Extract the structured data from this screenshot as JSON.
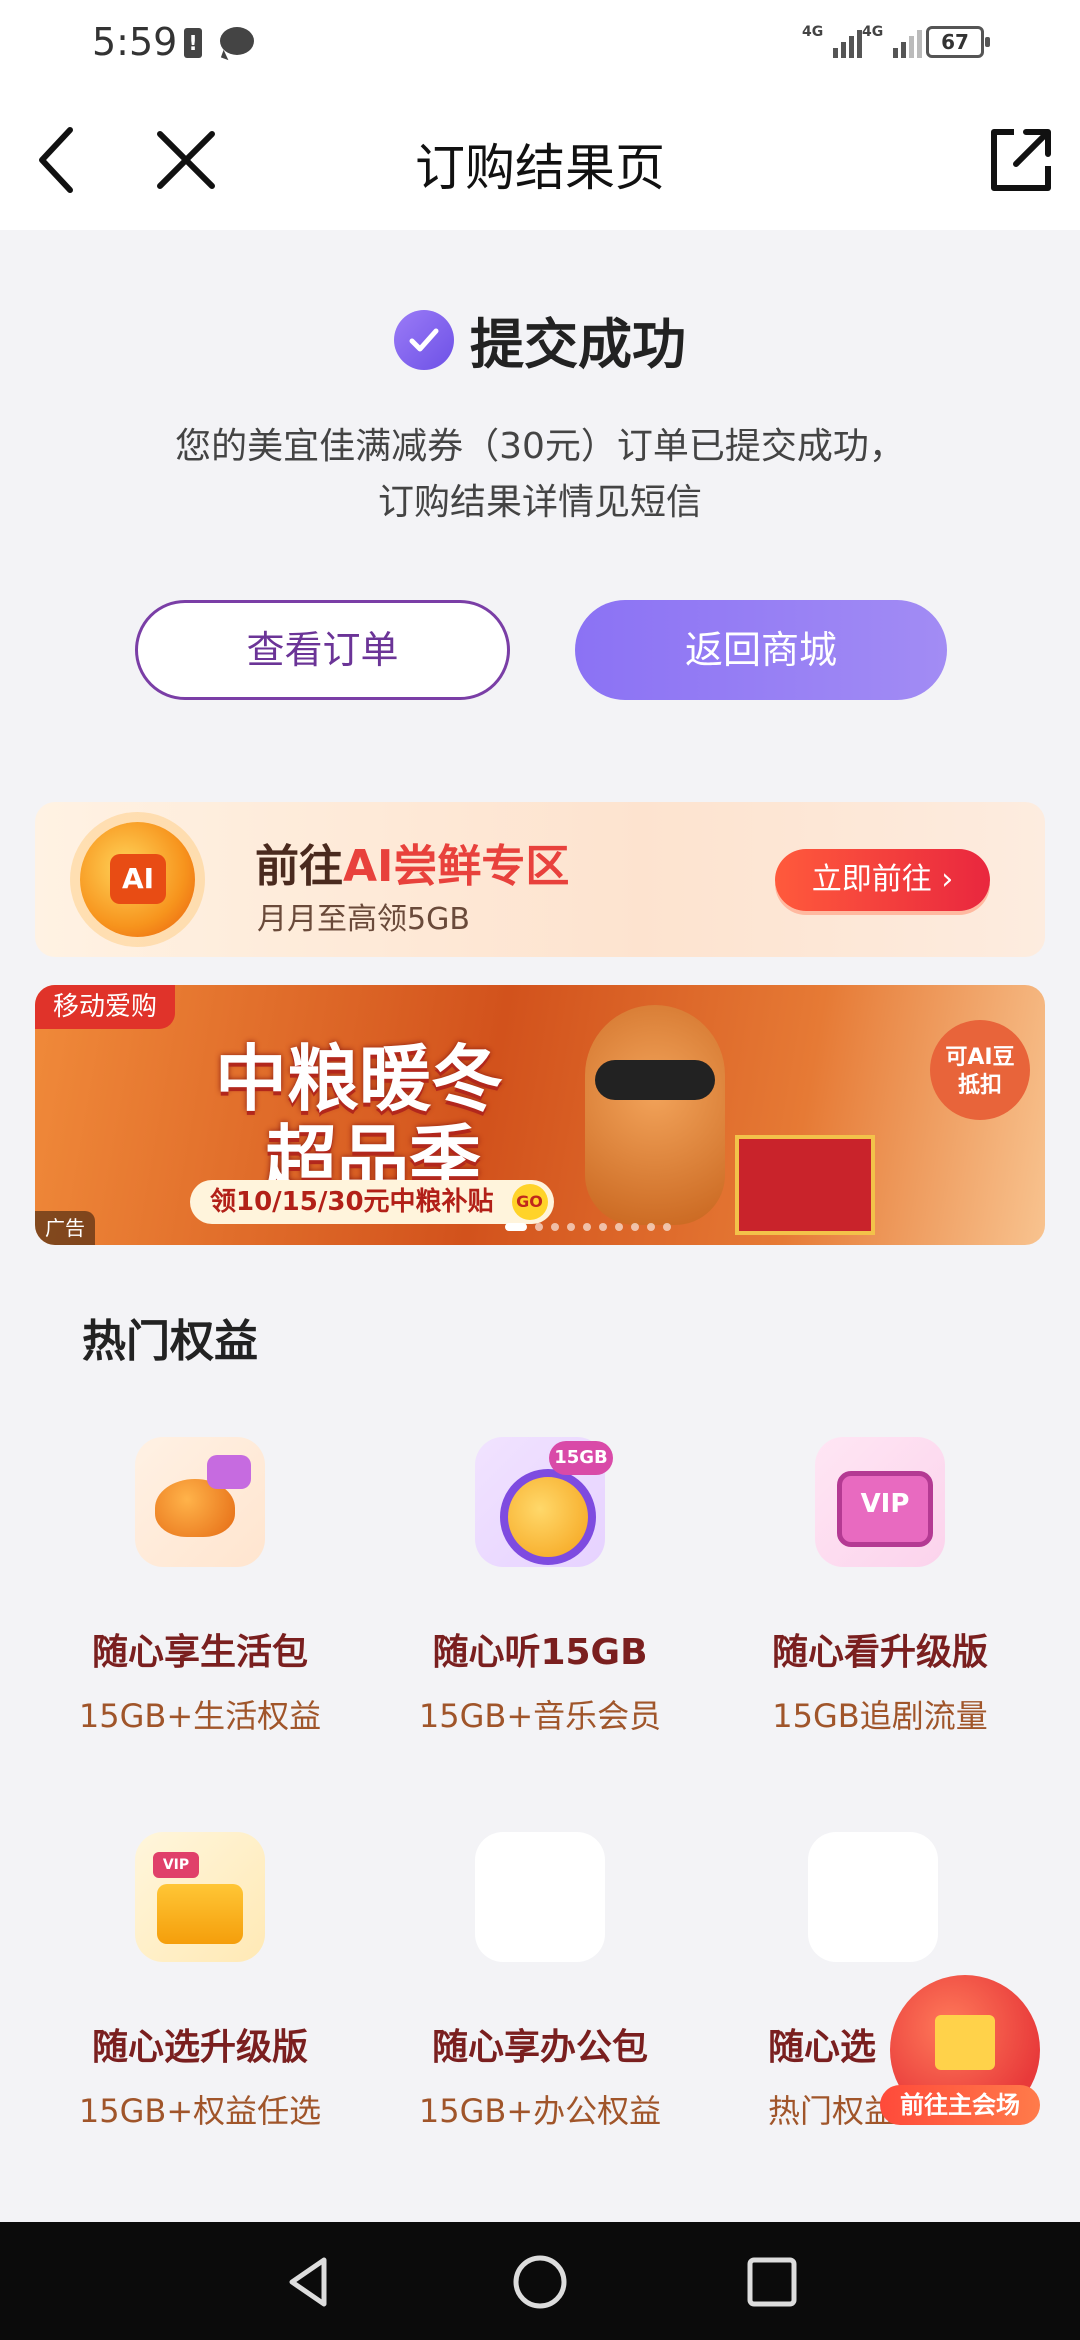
{
  "status_bar": {
    "time": "5:59",
    "alert": "!",
    "signal1": "4G",
    "signal2": "4G",
    "battery": "67"
  },
  "header": {
    "title": "订购结果页"
  },
  "result": {
    "title": "提交成功",
    "desc_line1": "您的美宜佳满减券（30元）订单已提交成功，",
    "desc_line2": "订购结果详情见短信",
    "view_order": "查看订单",
    "back_to_mall": "返回商城"
  },
  "ai_banner": {
    "icon_text": "AI",
    "title_prefix": "前往",
    "title_highlight": "AI尝鲜专区",
    "subtitle": "月月至高领5GB",
    "button": "立即前往 ›"
  },
  "ad_banner": {
    "brand": "移动爱购",
    "title_line1": "中粮暖冬",
    "title_line2": "超品季",
    "pill": "领10/15/30元中粮补贴",
    "pill_go": "GO",
    "coin_line1": "可AI豆",
    "coin_line2": "抵扣",
    "ad_tag": "广告"
  },
  "benefits": {
    "title": "热门权益",
    "items": [
      {
        "name": "随心享生活包",
        "desc": "15GB+生活权益"
      },
      {
        "name": "随心听15GB",
        "desc": "15GB+音乐会员"
      },
      {
        "name": "随心看升级版",
        "desc": "15GB追剧流量"
      },
      {
        "name": "随心选升级版",
        "desc": "15GB+权益任选"
      },
      {
        "name": "随心享办公包",
        "desc": "15GB+办公权益"
      },
      {
        "name": "随心选",
        "desc": "热门权益"
      }
    ]
  },
  "float_badge": {
    "label": "前往主会场"
  },
  "colors": {
    "accent": "#8b72f4",
    "benefit_name": "#7a1f1f",
    "benefit_desc": "#a0552a"
  }
}
